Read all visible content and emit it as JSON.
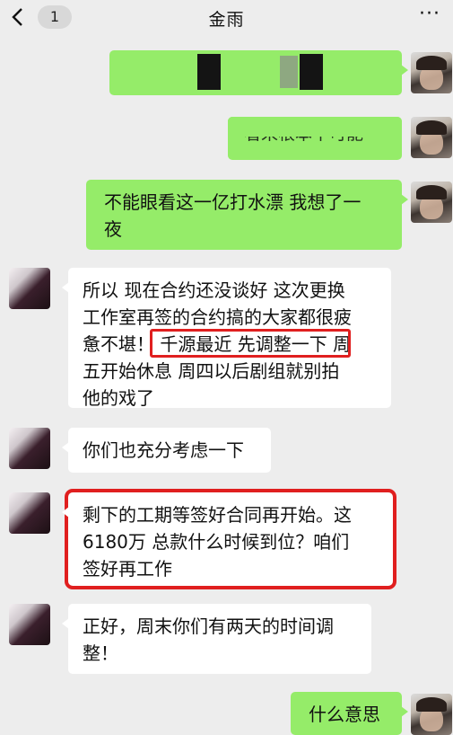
{
  "header": {
    "back_icon": "chevron-left-icon",
    "unread_count": "1",
    "title": "金雨",
    "more_icon": "ellipsis-icon"
  },
  "messages": [
    {
      "sender": "me",
      "text": ""
    },
    {
      "sender": "me",
      "text": "看来根本不可能"
    },
    {
      "sender": "me",
      "text": "不能眼看这一亿打水漂 我想了一\n夜"
    },
    {
      "sender": "other",
      "text": "所以 现在合约还没谈好 这次更换\n工作室再签的合约搞的大家都很疲\n惫不堪！ 千源最近 先调整一下 周\n五开始休息 周四以后剧组就别拍\n他的戏了"
    },
    {
      "sender": "other",
      "text": "你们也充分考虑一下"
    },
    {
      "sender": "other",
      "text": "剩下的工期等签好合同再开始。这\n6180万 总款什么时候到位？咱们\n签好再工作"
    },
    {
      "sender": "other",
      "text": "正好，周末你们有两天的时间调\n整！"
    },
    {
      "sender": "me",
      "text": "什么意思"
    }
  ],
  "colors": {
    "background": "#ededed",
    "outgoing_bubble": "#95ec69",
    "incoming_bubble": "#ffffff",
    "highlight": "#e01f1f"
  }
}
